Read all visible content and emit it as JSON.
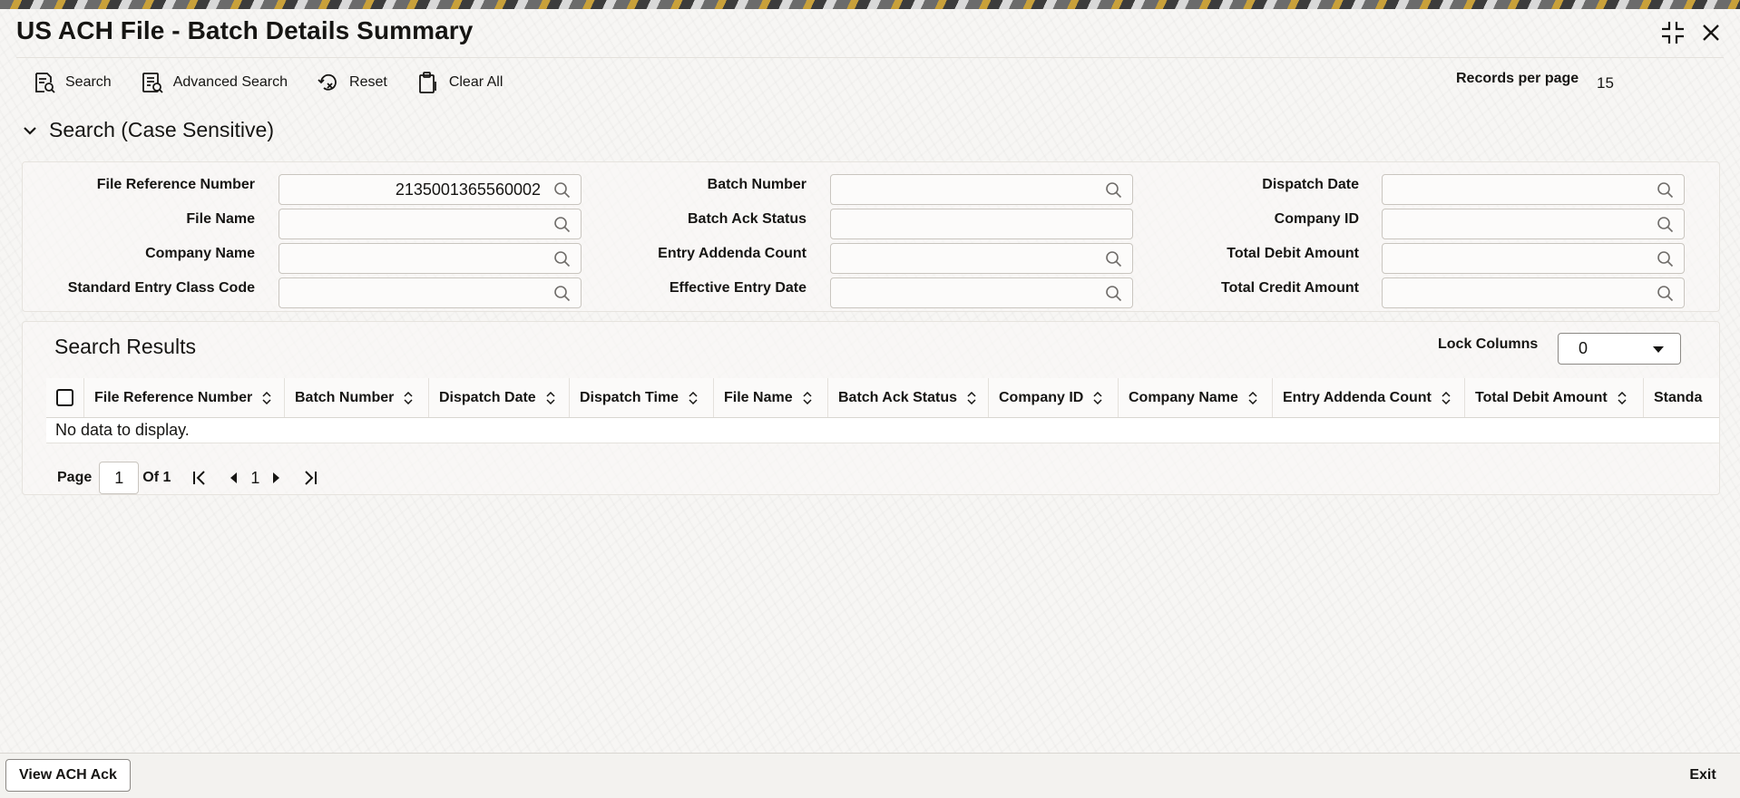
{
  "window": {
    "title": "US ACH File - Batch Details Summary"
  },
  "toolbar": {
    "search": "Search",
    "advanced_search": "Advanced Search",
    "reset": "Reset",
    "clear_all": "Clear All",
    "records_per_page_label": "Records per page",
    "records_per_page_value": "15"
  },
  "search_section": {
    "title": "Search (Case Sensitive)"
  },
  "fields": {
    "file_reference_number": {
      "label": "File Reference Number",
      "value": "2135001365560002"
    },
    "file_name": {
      "label": "File Name",
      "value": ""
    },
    "company_name": {
      "label": "Company Name",
      "value": ""
    },
    "standard_entry_class_code": {
      "label": "Standard Entry Class Code",
      "value": ""
    },
    "batch_number": {
      "label": "Batch Number",
      "value": ""
    },
    "batch_ack_status": {
      "label": "Batch Ack Status",
      "value": ""
    },
    "entry_addenda_count": {
      "label": "Entry Addenda Count",
      "value": ""
    },
    "effective_entry_date": {
      "label": "Effective Entry Date",
      "value": ""
    },
    "dispatch_date": {
      "label": "Dispatch Date",
      "value": ""
    },
    "company_id": {
      "label": "Company ID",
      "value": ""
    },
    "total_debit_amount": {
      "label": "Total Debit Amount",
      "value": ""
    },
    "total_credit_amount": {
      "label": "Total Credit Amount",
      "value": ""
    }
  },
  "results": {
    "title": "Search Results",
    "lock_columns_label": "Lock Columns",
    "lock_columns_value": "0",
    "columns": [
      "File Reference Number",
      "Batch Number",
      "Dispatch Date",
      "Dispatch Time",
      "File Name",
      "Batch Ack Status",
      "Company ID",
      "Company Name",
      "Entry Addenda Count",
      "Total Debit Amount",
      "Standa"
    ],
    "empty_message": "No data to display."
  },
  "pagination": {
    "page_label": "Page",
    "page_value": "1",
    "of_label": "Of 1",
    "current": "1"
  },
  "footer": {
    "view_ack": "View ACH Ack",
    "exit": "Exit"
  },
  "icons": {
    "search": "search-icon",
    "advanced_search": "advanced-search-icon",
    "reset": "reset-icon",
    "clear_all": "clipboard-clear-icon",
    "collapse": "collapse-icon",
    "close": "close-icon",
    "field_lookup": "magnifier-icon",
    "sort": "sort-icon"
  }
}
